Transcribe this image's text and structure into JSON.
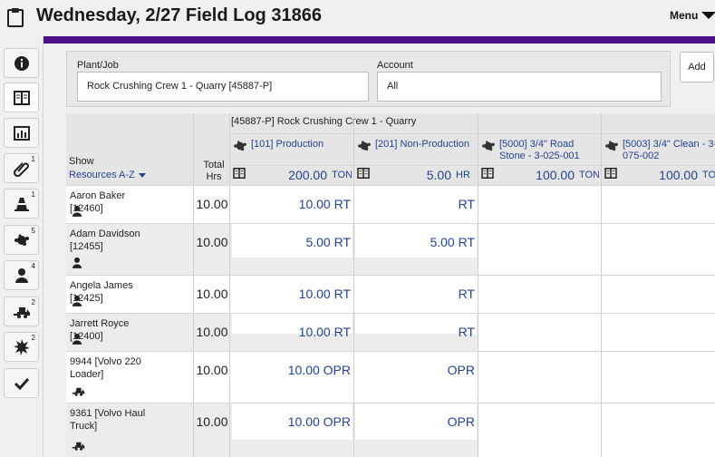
{
  "header": {
    "title": "Wednesday, 2/27 Field Log 31866",
    "menu_label": "Menu",
    "accent_color": "#4b0f86"
  },
  "sidebar": {
    "items": [
      {
        "icon": "info-icon",
        "badge": ""
      },
      {
        "icon": "book-icon",
        "badge": ""
      },
      {
        "icon": "bar-chart-icon",
        "badge": ""
      },
      {
        "icon": "paperclip-icon",
        "badge": "1"
      },
      {
        "icon": "cone-icon",
        "badge": "1"
      },
      {
        "icon": "material-icon",
        "badge": "5"
      },
      {
        "icon": "person-icon",
        "badge": "4"
      },
      {
        "icon": "loader-icon",
        "badge": "2"
      },
      {
        "icon": "burst-icon",
        "badge": "2"
      },
      {
        "icon": "check-icon",
        "badge": ""
      }
    ]
  },
  "form": {
    "plant_label": "Plant/Job",
    "plant_value": "Rock Crushing Crew 1 - Quarry [45887-P]",
    "account_label": "Account",
    "account_value": "All",
    "add_label": "Add"
  },
  "grid": {
    "job_header": "[45887-P] Rock Crushing Crew 1 - Quarry",
    "show_label": "Show",
    "sort_label": "Resources A-Z",
    "total_label_1": "Total",
    "total_label_2": "Hrs",
    "columns": [
      {
        "name": "[101] Production",
        "qty": "200.00",
        "unit": "TON"
      },
      {
        "name": "[201] Non-Production",
        "qty": "5.00",
        "unit": "HR"
      },
      {
        "name": "[5000] 3/4\" Road Stone - 3-025-001",
        "qty": "100.00",
        "unit": "TON"
      },
      {
        "name": "[5003] 3/4\" Clean - 3-075-002",
        "qty": "100.00",
        "unit": "TO"
      }
    ],
    "rows": [
      {
        "name": "Aaron Baker [12460]",
        "type": "person",
        "hrs": "10.00",
        "c1": "10.00 RT",
        "c2": "RT"
      },
      {
        "name": "Adam Davidson [12455]",
        "type": "person",
        "hrs": "10.00",
        "c1": "5.00 RT",
        "c2": "5.00 RT"
      },
      {
        "name": "Angela James [12425]",
        "type": "person",
        "hrs": "10.00",
        "c1": "10.00 RT",
        "c2": "RT"
      },
      {
        "name": "Jarrett Royce [12400]",
        "type": "person",
        "hrs": "10.00",
        "c1": "10.00 RT",
        "c2": "RT"
      },
      {
        "name": "9944 [Volvo 220 Loader]",
        "type": "equipment",
        "hrs": "10.00",
        "c1": "10.00 OPR",
        "c2": "OPR"
      },
      {
        "name": "9361 [Volvo Haul Truck]",
        "type": "equipment",
        "hrs": "10.00",
        "c1": "10.00 OPR",
        "c2": "OPR"
      }
    ]
  }
}
